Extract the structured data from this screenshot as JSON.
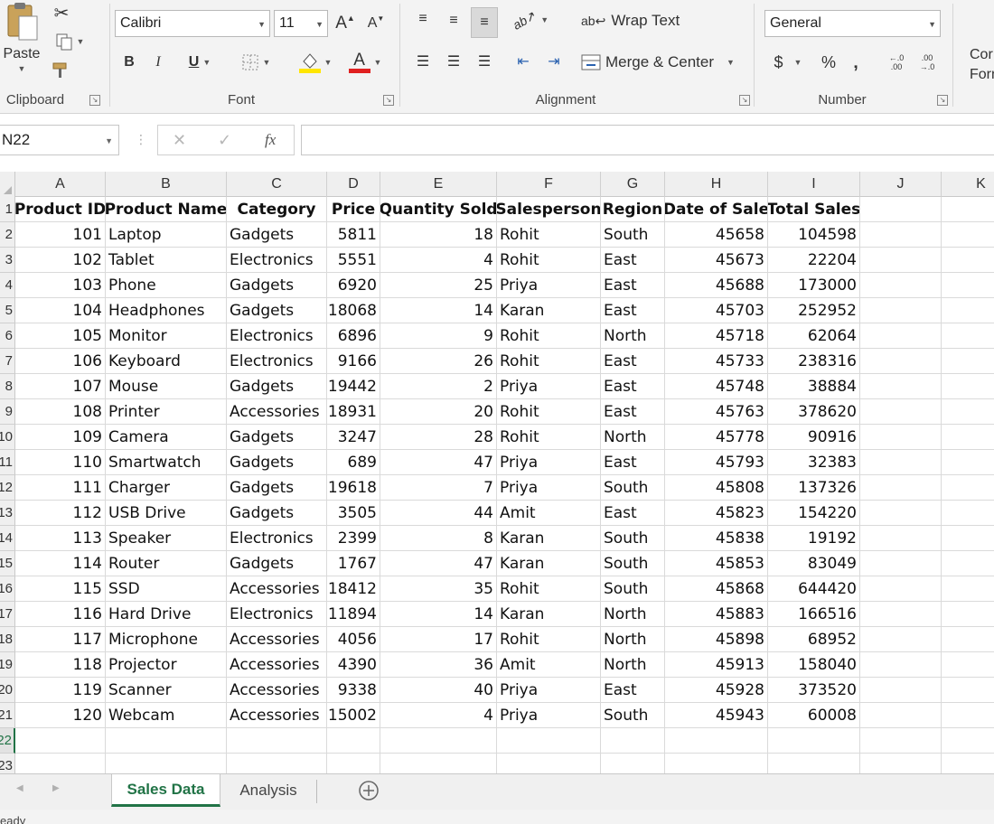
{
  "ribbon": {
    "clipboard": {
      "label": "Clipboard",
      "paste_label": "Paste"
    },
    "font": {
      "label": "Font",
      "font_name": "Calibri",
      "font_size": "11",
      "bold": "B",
      "italic": "I",
      "underline": "U",
      "grow": "A",
      "shrink": "A",
      "font_color_letter": "A"
    },
    "alignment": {
      "label": "Alignment",
      "wrap_text": "Wrap Text",
      "merge_center": "Merge & Center"
    },
    "number": {
      "label": "Number",
      "format": "General",
      "currency": "$",
      "percent": "%",
      "comma": "‚",
      "inc_decimal": "←.0 .00",
      "dec_decimal": ".00 →.0"
    },
    "styles_partial": {
      "line1": "Cor",
      "line2": "Form"
    }
  },
  "formula_bar": {
    "name_box": "N22",
    "fx": "fx",
    "cancel": "✕",
    "enter": "✓",
    "value": ""
  },
  "columns": [
    "A",
    "B",
    "C",
    "D",
    "E",
    "F",
    "G",
    "H",
    "I",
    "J",
    "K"
  ],
  "row_numbers": [
    "1",
    "2",
    "3",
    "4",
    "5",
    "6",
    "7",
    "8",
    "9",
    "10",
    "11",
    "12",
    "13",
    "14",
    "15",
    "16",
    "17",
    "18",
    "19",
    "20",
    "21",
    "22",
    "23"
  ],
  "active_row_index": 21,
  "table": {
    "headers": [
      "Product ID",
      "Product Name",
      "Category",
      "Price",
      "Quantity Sold",
      "Salesperson",
      "Region",
      "Date of Sale",
      "Total Sales"
    ],
    "rows": [
      [
        "101",
        "Laptop",
        "Gadgets",
        "5811",
        "18",
        "Rohit",
        "South",
        "45658",
        "104598"
      ],
      [
        "102",
        "Tablet",
        "Electronics",
        "5551",
        "4",
        "Rohit",
        "East",
        "45673",
        "22204"
      ],
      [
        "103",
        "Phone",
        "Gadgets",
        "6920",
        "25",
        "Priya",
        "East",
        "45688",
        "173000"
      ],
      [
        "104",
        "Headphones",
        "Gadgets",
        "18068",
        "14",
        "Karan",
        "East",
        "45703",
        "252952"
      ],
      [
        "105",
        "Monitor",
        "Electronics",
        "6896",
        "9",
        "Rohit",
        "North",
        "45718",
        "62064"
      ],
      [
        "106",
        "Keyboard",
        "Electronics",
        "9166",
        "26",
        "Rohit",
        "East",
        "45733",
        "238316"
      ],
      [
        "107",
        "Mouse",
        "Gadgets",
        "19442",
        "2",
        "Priya",
        "East",
        "45748",
        "38884"
      ],
      [
        "108",
        "Printer",
        "Accessories",
        "18931",
        "20",
        "Rohit",
        "East",
        "45763",
        "378620"
      ],
      [
        "109",
        "Camera",
        "Gadgets",
        "3247",
        "28",
        "Rohit",
        "North",
        "45778",
        "90916"
      ],
      [
        "110",
        "Smartwatch",
        "Gadgets",
        "689",
        "47",
        "Priya",
        "East",
        "45793",
        "32383"
      ],
      [
        "111",
        "Charger",
        "Gadgets",
        "19618",
        "7",
        "Priya",
        "South",
        "45808",
        "137326"
      ],
      [
        "112",
        "USB Drive",
        "Gadgets",
        "3505",
        "44",
        "Amit",
        "East",
        "45823",
        "154220"
      ],
      [
        "113",
        "Speaker",
        "Electronics",
        "2399",
        "8",
        "Karan",
        "South",
        "45838",
        "19192"
      ],
      [
        "114",
        "Router",
        "Gadgets",
        "1767",
        "47",
        "Karan",
        "South",
        "45853",
        "83049"
      ],
      [
        "115",
        "SSD",
        "Accessories",
        "18412",
        "35",
        "Rohit",
        "South",
        "45868",
        "644420"
      ],
      [
        "116",
        "Hard Drive",
        "Electronics",
        "11894",
        "14",
        "Karan",
        "North",
        "45883",
        "166516"
      ],
      [
        "117",
        "Microphone",
        "Accessories",
        "4056",
        "17",
        "Rohit",
        "North",
        "45898",
        "68952"
      ],
      [
        "118",
        "Projector",
        "Accessories",
        "4390",
        "36",
        "Amit",
        "North",
        "45913",
        "158040"
      ],
      [
        "119",
        "Scanner",
        "Accessories",
        "9338",
        "40",
        "Priya",
        "East",
        "45928",
        "373520"
      ],
      [
        "120",
        "Webcam",
        "Accessories",
        "15002",
        "4",
        "Priya",
        "South",
        "45943",
        "60008"
      ]
    ]
  },
  "sheets": [
    {
      "name": "Sales Data",
      "active": true
    },
    {
      "name": "Analysis",
      "active": false
    }
  ],
  "status": {
    "text": "eady"
  },
  "colors": {
    "excel_green": "#217346",
    "font_red": "#e02020",
    "fill_yellow": "#ffe600"
  },
  "icons": [
    "cut-icon",
    "copy-icon",
    "format-painter-icon",
    "paste-icon",
    "border-icon",
    "fill-color-icon",
    "font-color-icon",
    "orientation-icon",
    "wrap-text-icon",
    "merge-icon",
    "add-sheet-icon",
    "fx-icon"
  ]
}
